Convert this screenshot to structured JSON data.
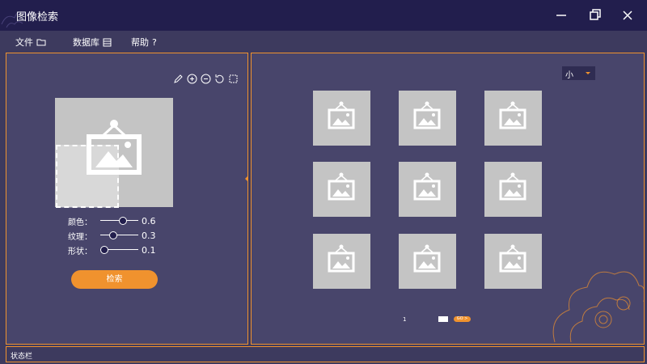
{
  "app": {
    "title": "图像检索"
  },
  "menu": [
    {
      "label": "文件",
      "icon": "folder-icon"
    },
    {
      "label": "数据库",
      "icon": "database-icon"
    },
    {
      "label": "帮助",
      "icon": "help-icon"
    }
  ],
  "help_glyph": "?",
  "left": {
    "tools": [
      "pencil-icon",
      "zoom-in-icon",
      "zoom-out-icon",
      "rotate-icon",
      "crop-icon"
    ],
    "sliders": [
      {
        "label": "颜色：",
        "value": "0.6",
        "level": 0.6
      },
      {
        "label": "纹理：",
        "value": "0.3",
        "level": 0.35
      },
      {
        "label": "形状：",
        "value": "0.1",
        "level": 0.1
      }
    ],
    "search_label": "检索"
  },
  "right": {
    "size_select": "小",
    "results_count": 9,
    "page_number": "1",
    "go_label": "GO >"
  },
  "status": {
    "text": "状态栏"
  },
  "colors": {
    "accent": "#f0922e",
    "titlebar": "#221e4d",
    "panel": "#48456b",
    "thumb": "#c4c4c4"
  }
}
